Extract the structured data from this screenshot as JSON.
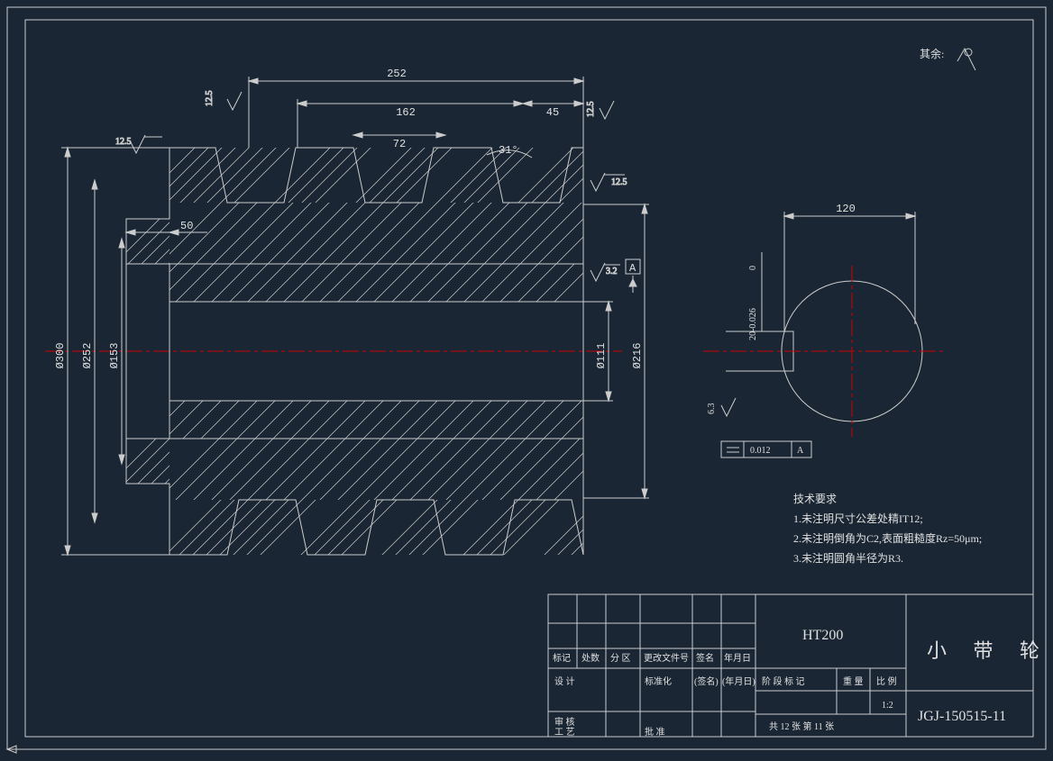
{
  "frame": {
    "general_symbol_label": "其余:",
    "drawing_number": "JGJ-150515-11",
    "part_name": "小 带 轮",
    "material": "HT200",
    "scale": "1:2",
    "sheet_info": "共 12 张    第 11 张"
  },
  "main_view": {
    "dims": {
      "overall_width": "252",
      "groove_span": "162",
      "groove_gap": "72",
      "end_width_right": "45",
      "hub_step": "50",
      "angle": "31°",
      "diam_outer": "Ø300",
      "diam_step1": "Ø252",
      "diam_step2": "Ø153",
      "diam_bore": "Ø111",
      "diam_right": "Ø216"
    },
    "surf": {
      "s1": "12.5",
      "s2": "12.5",
      "s3": "3.2",
      "s4": "12.5",
      "s5": "12.5"
    },
    "datum": "A"
  },
  "side_view": {
    "key_width_dim": "120",
    "key_tol_dim_upper": "0",
    "key_tol_dim_lower": "20-0.026",
    "surf": "6.3",
    "gtol_value": "0.012",
    "gtol_ref": "A"
  },
  "notes": {
    "heading": "技术要求",
    "n1": "1.未注明尺寸公差处精IT12;",
    "n2": "2.未注明倒角为C2,表面粗糙度Rz=50μm;",
    "n3": "3.未注明圆角半径为R3."
  },
  "title_block_labels": {
    "r1c1": "标记",
    "r1c2": "处数",
    "r1c3": "分 区",
    "r1c4": "更改文件号",
    "r1c5": "签名",
    "r1c6": "年月日",
    "r2c1": "设 计",
    "r2c4": "标准化",
    "r2c5": "(签名)",
    "r2c6": "(年月日)",
    "r3c1": "审 核",
    "r4c1": "工 艺",
    "r4c2": "批 准",
    "stage": "阶 段 标 记",
    "mass": "重 量",
    "ratio": "比 例"
  }
}
